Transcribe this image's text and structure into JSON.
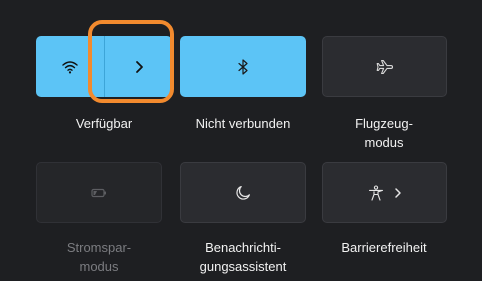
{
  "quick_settings": {
    "tiles": {
      "wifi": {
        "label": "Verfügbar",
        "state": "on",
        "icon": "wifi-icon",
        "expand_icon": "chevron-right-icon"
      },
      "bluetooth": {
        "label": "Nicht verbunden",
        "state": "on",
        "icon": "bluetooth-icon"
      },
      "airplane": {
        "label": "Flugzeug-\nmodus",
        "state": "off",
        "icon": "airplane-icon"
      },
      "battery_saver": {
        "label": "Stromspar-\nmodus",
        "state": "disabled",
        "icon": "battery-saver-icon"
      },
      "focus_assist": {
        "label": "Benachrichti-\ngungsassistent",
        "state": "off",
        "icon": "moon-icon"
      },
      "accessibility": {
        "label": "Barrierefreiheit",
        "state": "off",
        "icon": "accessibility-icon",
        "expand_icon": "chevron-right-icon"
      }
    }
  },
  "colors": {
    "panel_background": "#1e1f22",
    "active_tile": "#5cc4f6",
    "inactive_tile": "#2b2c30",
    "highlight_outline": "#f28a2e"
  }
}
